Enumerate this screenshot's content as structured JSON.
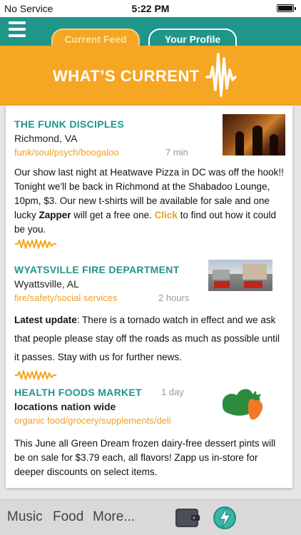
{
  "status_bar": {
    "carrier": "No Service",
    "time": "5:22 PM",
    "battery_level": 1.0
  },
  "header": {
    "menu_icon": "hamburger-icon",
    "tabs": [
      {
        "label": "Current Feed",
        "active": true
      },
      {
        "label": "Your Profile",
        "active": false
      }
    ]
  },
  "banner": {
    "title": "WHAT’S CURRENT",
    "icon": "waveform-icon"
  },
  "posts": [
    {
      "name": "THE FUNK DISCIPLES",
      "location": "Richmond, VA",
      "tags": "funk/soul/psych/boogaloo",
      "age": "7 min",
      "image": "band-photo",
      "body": {
        "text_a": "Our show last night at Heatwave Pizza in DC was off the hook!! Tonight we'll be back in Richmond at the Shabadoo Lounge, 10pm, $3. Our new t-shirts will be available for sale and one lucky ",
        "bold": "Zapper",
        "text_b": " will get a free one. ",
        "link": "Click",
        "text_c": " to find out how it could be you."
      }
    },
    {
      "name": "WYATSVILLE FIRE DEPARTMENT",
      "location": "Wyattsville, AL",
      "tags": "fire/safety/social services",
      "age": "2 hours",
      "image": "fire-station-photo",
      "body": {
        "label": "Latest update",
        "text": ": There is a tornado watch in effect and we ask that people please stay off the roads as much as possible until it passes. Stay with us for further news."
      }
    },
    {
      "name": "HEALTH FOODS MARKET",
      "subtitle": "locations nation wide",
      "tags": "organic food/grocery/supplements/deli",
      "age": "1 day",
      "image": "health-foods-logo",
      "body": {
        "text": "This June all Green Dream frozen dairy-free dessert pints will be on sale for $3.79 each, all flavors! Zapp us in-store for deeper discounts on select items."
      }
    }
  ],
  "bottom_nav": {
    "items": [
      "Music",
      "Food",
      "More..."
    ],
    "wallet_icon": "wallet-icon",
    "zap_icon": "lightning-icon"
  },
  "colors": {
    "teal": "#20958a",
    "orange": "#f5a623",
    "tag_orange": "#f0a020"
  }
}
